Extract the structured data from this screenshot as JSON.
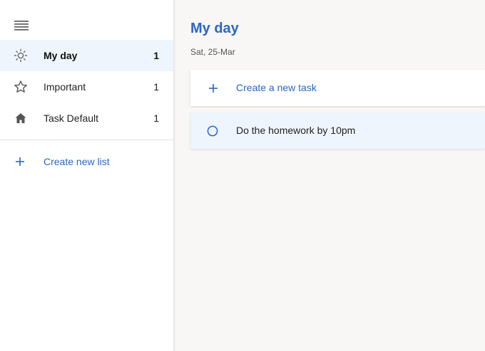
{
  "sidebar": {
    "menu_icon": "hamburger-menu-icon",
    "items": [
      {
        "label": "My day",
        "count": "1",
        "icon": "sun-icon",
        "active": true
      },
      {
        "label": "Important",
        "count": "1",
        "icon": "star-icon",
        "active": false
      },
      {
        "label": "Task Default",
        "count": "1",
        "icon": "home-icon",
        "active": false
      }
    ],
    "create_list_label": "Create new list"
  },
  "main": {
    "title": "My day",
    "date": "Sat, 25-Mar",
    "new_task_label": "Create a new task",
    "tasks": [
      {
        "label": "Do the homework by 10pm",
        "completed": false
      }
    ]
  },
  "colors": {
    "accent": "#2a66c4",
    "active_bg": "#eef5fc",
    "main_bg": "#f8f7f6"
  }
}
